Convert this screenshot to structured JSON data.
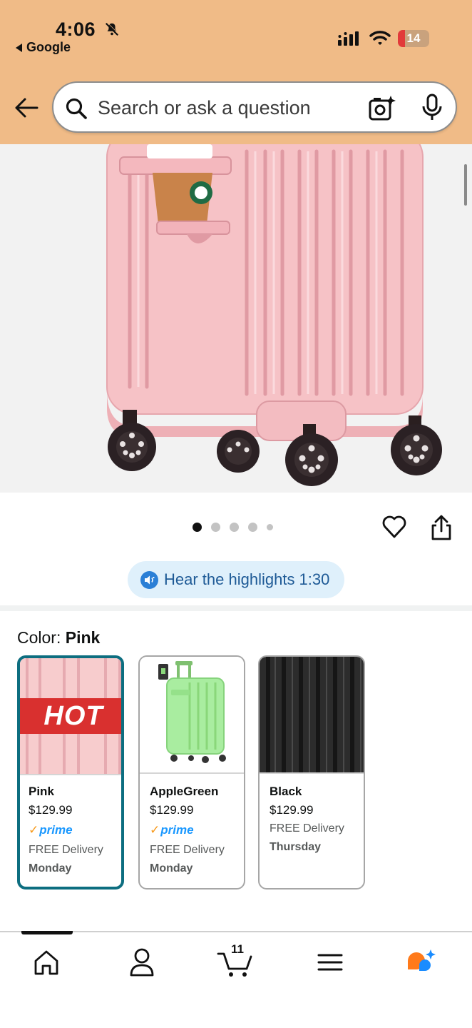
{
  "status_bar": {
    "time": "4:06",
    "back_app": "Google",
    "battery": "14"
  },
  "search": {
    "placeholder": "Search or ask a question"
  },
  "gallery": {
    "dot_count": 5,
    "active_dot": 1
  },
  "audio": {
    "label": "Hear the highlights 1:30"
  },
  "color_section": {
    "label": "Color:",
    "selected": "Pink"
  },
  "swatches": [
    {
      "name": "Pink",
      "price": "$129.99",
      "prime": "prime",
      "delivery": "FREE Delivery",
      "day": "Monday",
      "badge": "HOT"
    },
    {
      "name": "AppleGreen",
      "price": "$129.99",
      "prime": "prime",
      "delivery": "FREE Delivery",
      "day": "Monday"
    },
    {
      "name": "Black",
      "price": "$129.99",
      "delivery": "FREE Delivery",
      "day": "Thursday"
    }
  ],
  "nav": {
    "cart_count": "11",
    "items": [
      "home-icon",
      "account-icon",
      "cart-icon",
      "menu-icon",
      "rufus-icon"
    ]
  },
  "colors": {
    "header_bg": "#f0bb87",
    "selected_border": "#0d6e80",
    "prime_blue": "#1a98ff",
    "prime_check": "#f79a1c",
    "hot_red": "#d9302f",
    "audio_pill_bg": "#dff0fb"
  }
}
